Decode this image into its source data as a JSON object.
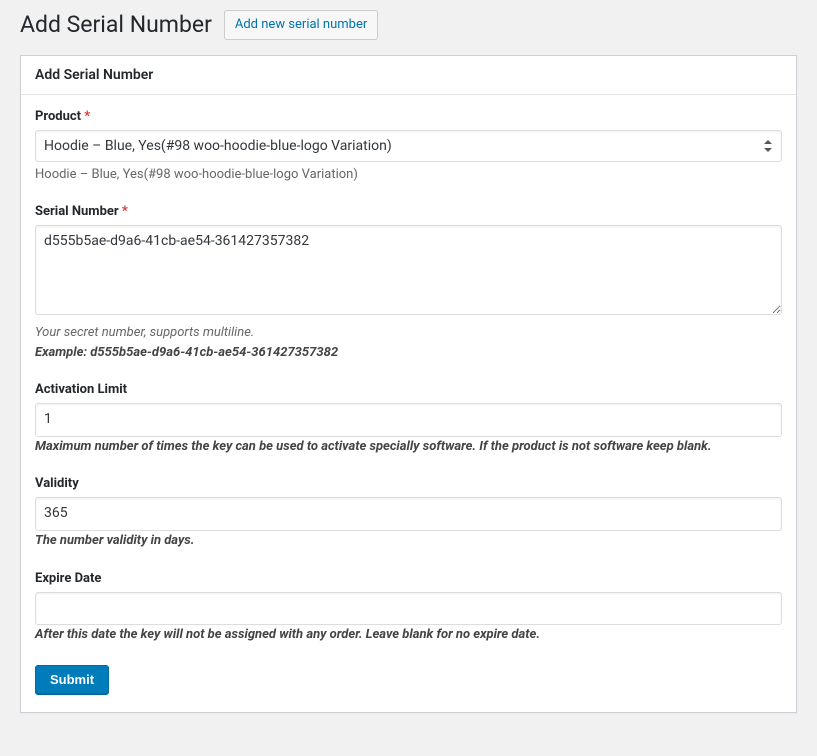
{
  "header": {
    "title": "Add Serial Number",
    "add_new_label": "Add new serial number"
  },
  "postbox": {
    "title": "Add Serial Number"
  },
  "form": {
    "product": {
      "label": "Product",
      "required_marker": "*",
      "selected_value": "Hoodie – Blue, Yes(#98 woo-hoodie-blue-logo Variation)",
      "selected_display": "Hoodie – Blue, Yes(#98 woo-hoodie-blue-logo Variation)"
    },
    "serial_number": {
      "label": "Serial Number",
      "required_marker": "*",
      "value": "d555b5ae-d9a6-41cb-ae54-361427357382",
      "description_line1": "Your secret number, supports multiline.",
      "description_line2": "Example: d555b5ae-d9a6-41cb-ae54-361427357382"
    },
    "activation_limit": {
      "label": "Activation Limit",
      "value": "1",
      "description": "Maximum number of times the key can be used to activate specially software. If the product is not software keep blank."
    },
    "validity": {
      "label": "Validity",
      "value": "365",
      "description": "The number validity in days."
    },
    "expire_date": {
      "label": "Expire Date",
      "value": "",
      "description": "After this date the key will not be assigned with any order. Leave blank for no expire date."
    },
    "submit_label": "Submit"
  }
}
